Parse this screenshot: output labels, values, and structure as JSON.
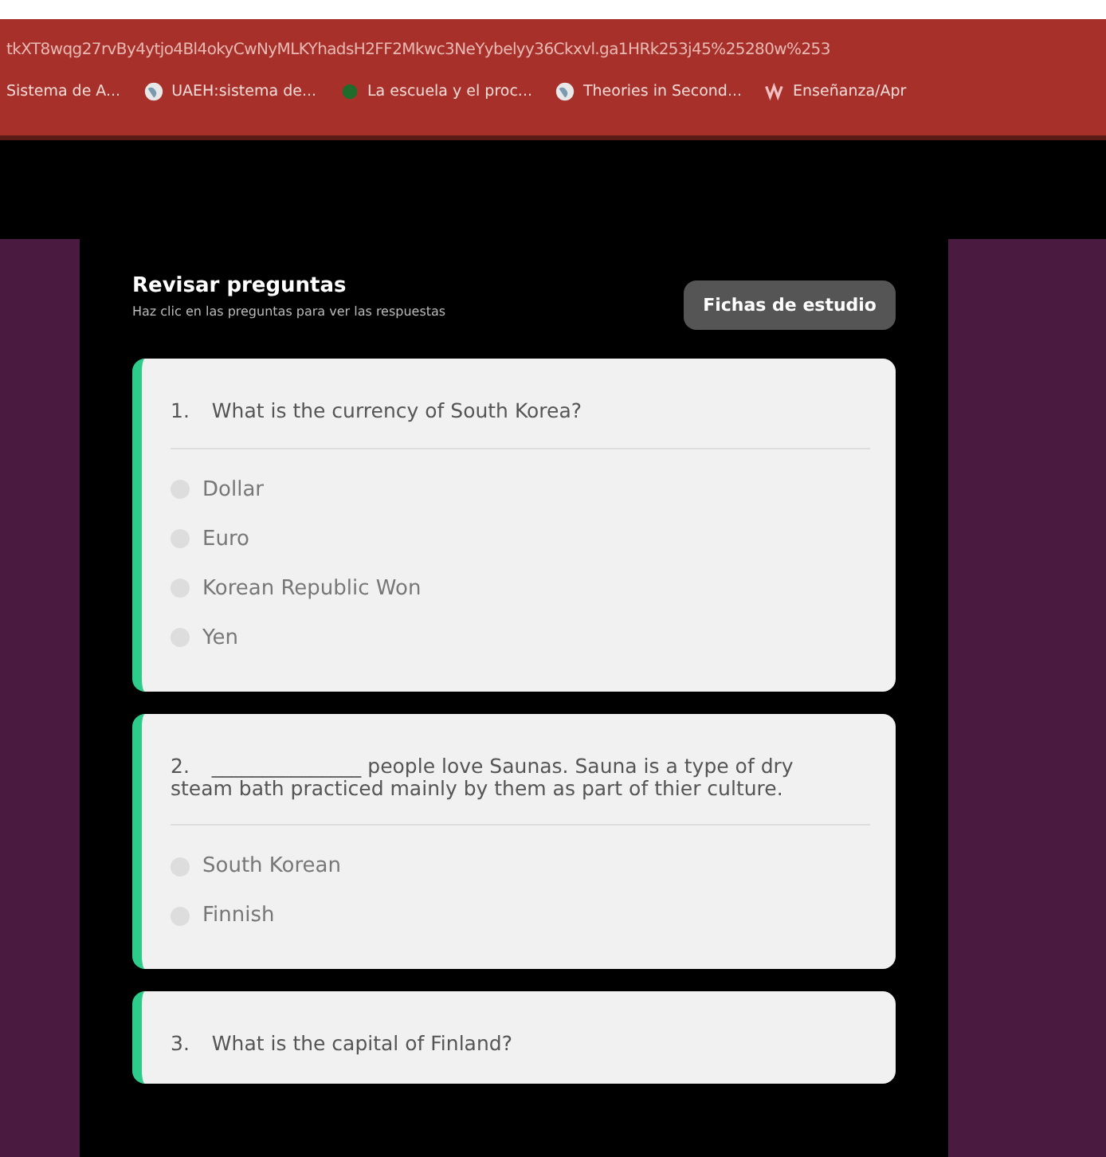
{
  "browser": {
    "url": "tkXT8wqg27rvBy4ytjo4Bl4okyCwNyMLKYhadsH2FF2Mkwc3NeYybelyy36Ckxvl.ga1HRk253j45%25280w%253",
    "bookmarks": [
      {
        "label": "Sistema de A...",
        "kind": "none"
      },
      {
        "label": "UAEH:sistema de...",
        "kind": "globe"
      },
      {
        "label": "La escuela y el proc...",
        "kind": "dot"
      },
      {
        "label": "Theories in Second...",
        "kind": "globe"
      },
      {
        "label": "Enseñanza/Apr",
        "kind": "logo"
      }
    ]
  },
  "review": {
    "title": "Revisar preguntas",
    "subtitle": "Haz clic en las preguntas para ver las respuestas",
    "button": "Fichas de estudio"
  },
  "questions": [
    {
      "number": "1.",
      "text": "What is the currency of South Korea?",
      "options": [
        {
          "label": "Dollar",
          "selected": false
        },
        {
          "label": "Euro",
          "selected": false
        },
        {
          "label": "Korean Republic Won",
          "selected": false
        },
        {
          "label": "Yen",
          "selected": false
        }
      ]
    },
    {
      "number": "2.",
      "text": "_______________ people love Saunas. Sauna is a type of dry steam bath practiced mainly by them as part of thier culture.",
      "options": [
        {
          "label": "South Korean",
          "selected": false
        },
        {
          "label": "Finnish",
          "selected": false
        }
      ]
    },
    {
      "number": "3.",
      "text": "What is the capital of Finland?"
    }
  ]
}
